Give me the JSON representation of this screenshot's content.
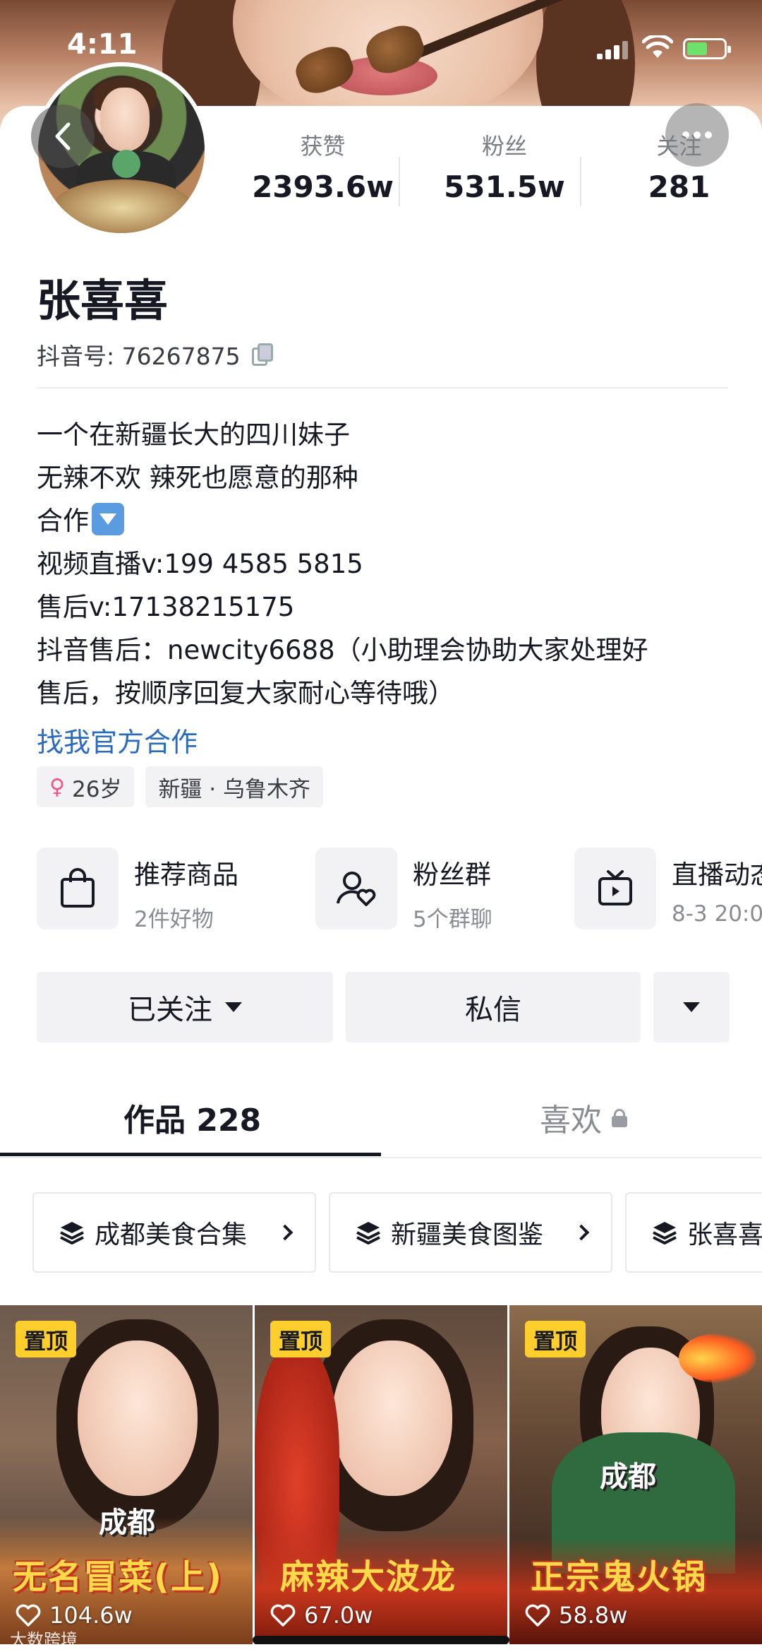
{
  "status_bar": {
    "time": "4:11"
  },
  "profile": {
    "name": "张喜喜",
    "douyin_id": "抖音号: 76267875",
    "stats": [
      {
        "label": "获赞",
        "value": "2393.6w"
      },
      {
        "label": "粉丝",
        "value": "531.5w"
      },
      {
        "label": "关注",
        "value": "281"
      }
    ],
    "bio_lines": [
      "一个在新疆长大的四川妹子",
      "无辣不欢  辣死也愿意的那种",
      "合作",
      "视频直播v:199 4585 5815",
      "售后v:17138215175",
      "抖音售后：newcity6688（小助理会协助大家处理好",
      "售后，按顺序回复大家耐心等待哦）"
    ],
    "official_link": "找我官方合作",
    "tags": {
      "age": "26岁",
      "location": "新疆 · 乌鲁木齐"
    }
  },
  "quick_entries": [
    {
      "icon": "shopping-bag-icon",
      "title": "推荐商品",
      "subtitle": "2件好物"
    },
    {
      "icon": "fan-group-icon",
      "title": "粉丝群",
      "subtitle": "5个群聊"
    },
    {
      "icon": "live-tv-icon",
      "title": "直播动态",
      "subtitle": "8-3 20:0"
    }
  ],
  "actions": {
    "followed": "已关注",
    "message": "私信"
  },
  "tabs": {
    "works": "作品 228",
    "likes": "喜欢"
  },
  "collections": [
    "成都美食合集",
    "新疆美食图鉴",
    "张喜喜"
  ],
  "videos": [
    {
      "pin": "置顶",
      "city": "成都",
      "title": "无名冒菜(上)",
      "likes": "104.6w"
    },
    {
      "pin": "置顶",
      "city": "",
      "title": "麻辣大波龙",
      "likes": "67.0w"
    },
    {
      "pin": "置顶",
      "city": "成都",
      "title": "正宗鬼火锅",
      "likes": "58.8w"
    }
  ],
  "watermark": "大数跨境",
  "colors": {
    "link": "#2a6bbf",
    "pin_badge": "#fece2c",
    "text": "#161823"
  }
}
